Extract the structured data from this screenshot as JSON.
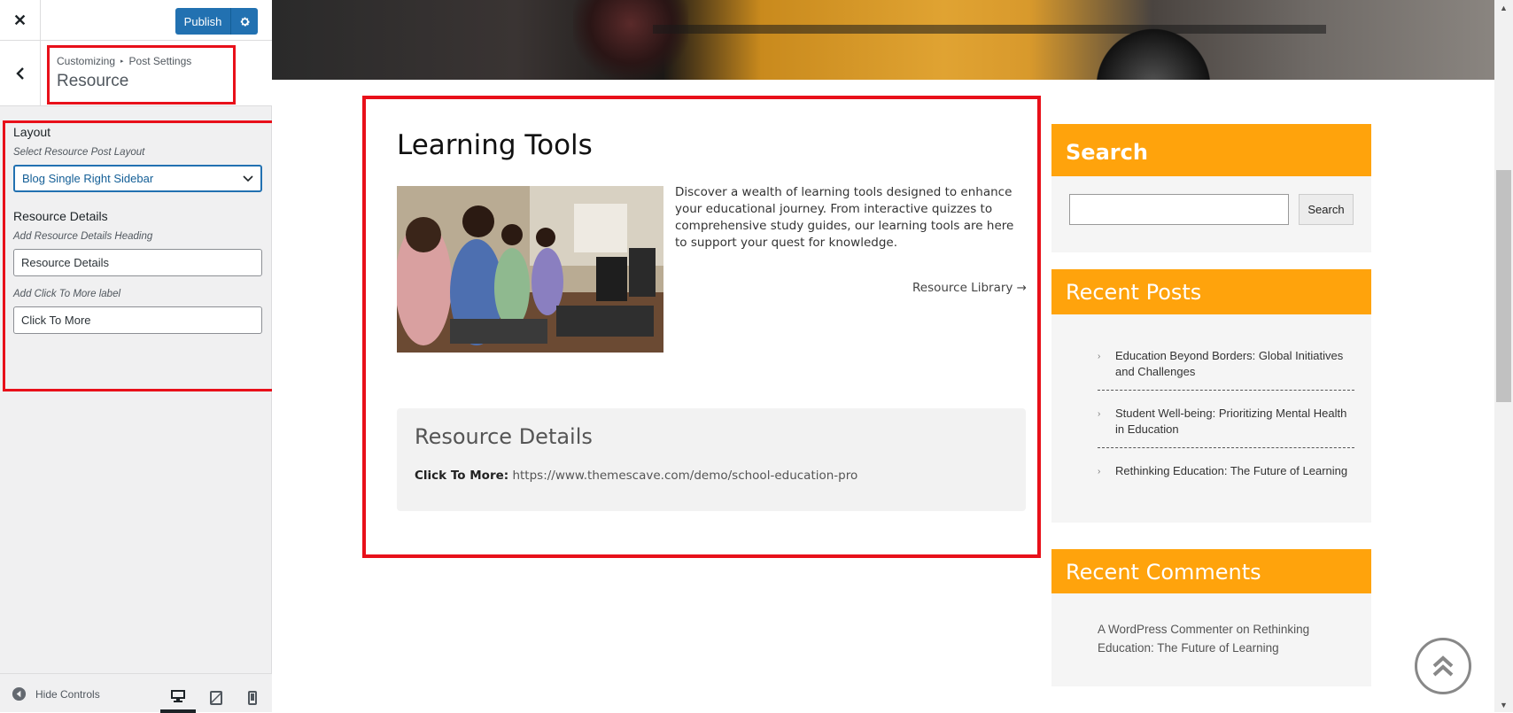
{
  "customizer": {
    "close_glyph": "✕",
    "publish_label": "Publish",
    "breadcrumb_root": "Customizing",
    "breadcrumb_sep": "▸",
    "breadcrumb_section": "Post Settings",
    "section_title": "Resource",
    "layout_heading": "Layout",
    "layout_desc": "Select Resource Post Layout",
    "layout_value": "Blog Single Right Sidebar",
    "details_heading": "Resource Details",
    "details_desc": "Add Resource Details Heading",
    "details_value": "Resource Details",
    "click_desc": "Add Click To More label",
    "click_value": "Click To More",
    "hide_controls": "Hide Controls"
  },
  "post": {
    "title": "Learning Tools",
    "text": "Discover a wealth of learning tools designed to enhance your educational journey. From interactive quizzes to comprehensive study guides, our learning tools are here to support your quest for knowledge.",
    "link": "Resource Library →",
    "details_heading": "Resource Details",
    "click_label": "Click To More:",
    "click_url": "https://www.themescave.com/demo/school-education-pro"
  },
  "sidebar_widgets": {
    "search_title": "Search",
    "search_button": "Search",
    "recent_posts_title": "Recent Posts",
    "recent_posts": [
      "Education Beyond Borders: Global Initiatives and Challenges",
      "Student Well-being: Prioritizing Mental Health in Education",
      "Rethinking Education: The Future of Learning"
    ],
    "recent_comments_title": "Recent Comments",
    "comment_author": "A WordPress Commenter",
    "comment_on": "on",
    "comment_post": "Rethinking Education: The Future of Learning"
  },
  "colors": {
    "accent": "#ffa30c",
    "publish": "#2271b1",
    "highlight": "#e8101a"
  }
}
